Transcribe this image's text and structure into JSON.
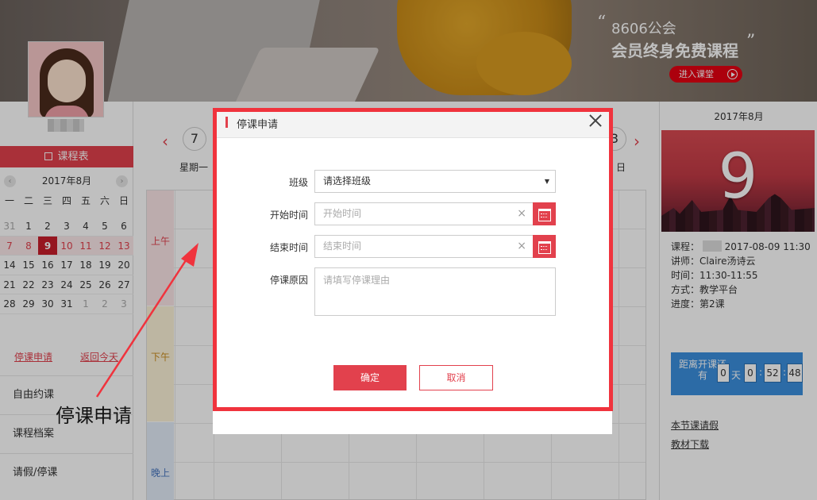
{
  "banner": {
    "title_line1": "8606公会",
    "title_line2": "会员终身免费课程",
    "quote_open": "“",
    "quote_close": "”",
    "enter_label": "进入课堂"
  },
  "left": {
    "schedule_label": "课程表",
    "month": "2017年8月",
    "prev": "‹",
    "next": "›",
    "weekdays": [
      "一",
      "二",
      "三",
      "四",
      "五",
      "六",
      "日"
    ],
    "days": [
      "31",
      "1",
      "2",
      "3",
      "4",
      "5",
      "6",
      "7",
      "8",
      "9",
      "10",
      "11",
      "12",
      "13",
      "14",
      "15",
      "16",
      "17",
      "18",
      "19",
      "20",
      "21",
      "22",
      "23",
      "24",
      "25",
      "26",
      "27",
      "28",
      "29",
      "30",
      "31",
      "1",
      "2",
      "3"
    ],
    "link_stop": "停课申请",
    "link_today": "返回今天",
    "menu": [
      "自由约课",
      "课程档案",
      "请假/停课"
    ]
  },
  "center": {
    "prev_arrow": "‹",
    "next_arrow": "›",
    "week_first": "7",
    "week_last": "3",
    "weekday_first": "星期一",
    "weekday_last": "日",
    "periods": {
      "am": "上午",
      "pm": "下午",
      "ev": "晚上"
    }
  },
  "right": {
    "month": "2017年8月",
    "day": "9",
    "course_label": "课程：",
    "course_value": "2017-08-09 11:30",
    "teacher": "讲师：Claire汤诗云",
    "time": "时间：11:30-11:55",
    "method": "方式：教学平台",
    "progress": "进度：第2课",
    "countdown_label": "距离开课还有",
    "cd_day": "0",
    "cd_day_unit": "天",
    "cd_h": "0",
    "cd_m": "52",
    "cd_s": "48",
    "colon": ":",
    "link_leave": "本节课请假",
    "link_download": "教材下载"
  },
  "annotation": "停课申请",
  "dialog": {
    "title": "停课申请",
    "class_label": "班级",
    "class_value": "请选择班级",
    "start_label": "开始时间",
    "start_placeholder": "开始时间",
    "end_label": "结束时间",
    "end_placeholder": "结束时间",
    "reason_label": "停课原因",
    "reason_placeholder": "请填写停课理由",
    "clear": "×",
    "caret": "▼",
    "ok": "确定",
    "cancel": "取消"
  },
  "colors": {
    "accent": "#e2414d",
    "frame": "#f0333d",
    "countdown": "#3b8fde"
  }
}
